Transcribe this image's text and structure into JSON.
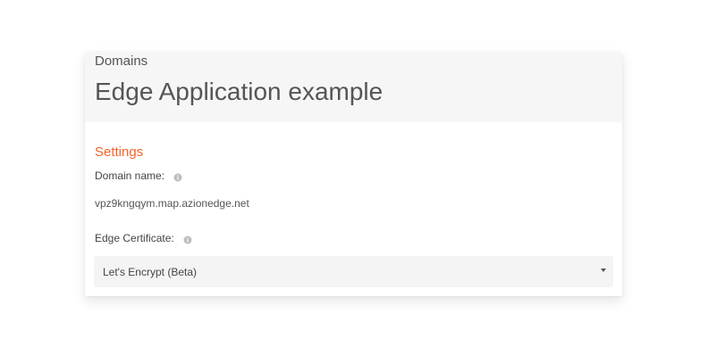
{
  "header": {
    "breadcrumb": "Domains",
    "title": "Edge Application example"
  },
  "settings": {
    "section_title": "Settings",
    "domain_name_label": "Domain name:",
    "domain_name_value": "vpz9kngqym.map.azionedge.net",
    "edge_certificate_label": "Edge Certificate:",
    "edge_certificate_selected": "Let's Encrypt (Beta)"
  },
  "icons": {
    "info": "info-icon",
    "dropdown": "caret-down-icon"
  },
  "colors": {
    "accent": "#f3652b",
    "header_bg": "#f6f6f6",
    "select_bg": "#f4f4f4"
  }
}
